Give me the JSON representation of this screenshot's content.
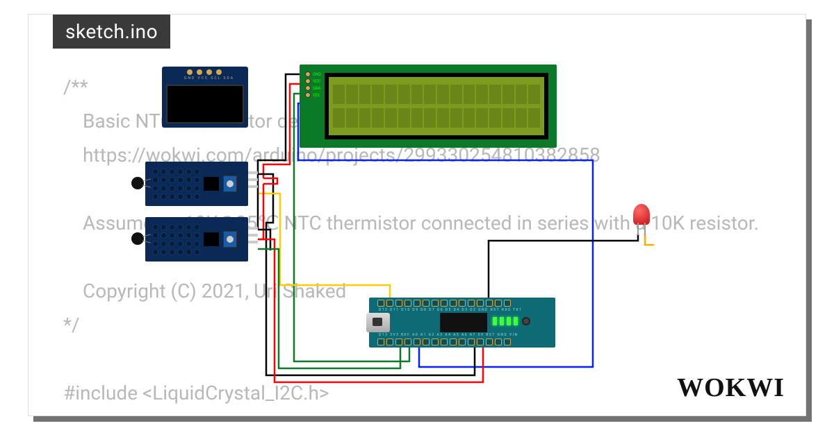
{
  "tab": {
    "filename": "sketch.ino"
  },
  "code": {
    "l1": "/**",
    "l2": "Basic NTC Thermistor demo",
    "l3": "https://wokwi.com/arduino/projects/299330254810382858",
    "l4": "",
    "l5": "Assumes a 10K@25℃ NTC thermistor connected in series with a 10K resistor.",
    "l6": "",
    "l7": "Copyright (C) 2021, Uri Shaked",
    "l8": "*/",
    "l9": "",
    "l10": "#include <LiquidCrystal_I2C.h>"
  },
  "oled": {
    "pin_labels": "GND VCC SCL SDA"
  },
  "lcd": {
    "pins": [
      "GND",
      "VCC",
      "SDA",
      "SCL"
    ]
  },
  "nano": {
    "top_labels": "D12 D11 D10 D9 D8 D7 D6 D5 D4 D3 D2 GND RST RX0 TX1",
    "bot_labels": "D13 3V3 REF A0 A1 A2 A3 A4 A5 A6 A7 5V RST GND VIN"
  },
  "components": {
    "oled_name": "ssd1306-oled",
    "lcd_name": "lcd-1602-i2c",
    "ntc1_name": "ntc-module-1",
    "ntc2_name": "ntc-module-2",
    "led_name": "led-red",
    "board_name": "arduino-nano"
  },
  "wire_colors": {
    "gnd": "#000000",
    "vcc": "#ff0000",
    "sda": "#0a7a28",
    "scl": "#0020ff",
    "a1": "#ffcc00",
    "led_sig": "#000000",
    "led_gnd": "#ffaa00"
  },
  "logo": "WOKWI"
}
